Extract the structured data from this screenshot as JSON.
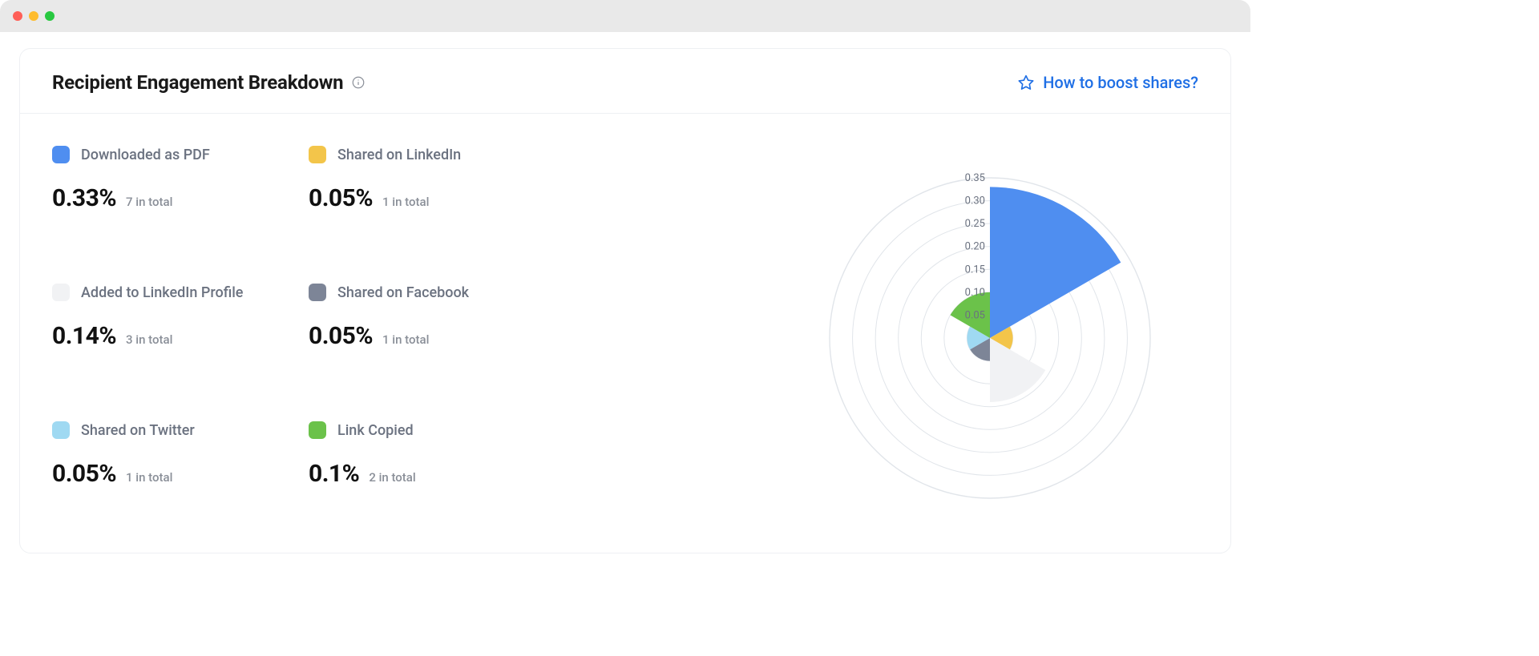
{
  "header": {
    "title": "Recipient Engagement Breakdown",
    "boost_link_label": "How to boost shares?"
  },
  "metrics": [
    {
      "key": "downloaded_pdf",
      "label": "Downloaded as PDF",
      "percent": "0.33%",
      "total": "7 in total",
      "color": "#4f8ef0"
    },
    {
      "key": "shared_linkedin",
      "label": "Shared on LinkedIn",
      "percent": "0.05%",
      "total": "1 in total",
      "color": "#f3c54a"
    },
    {
      "key": "added_linkedin",
      "label": "Added to LinkedIn Profile",
      "percent": "0.14%",
      "total": "3 in total",
      "color": "#f1f2f4"
    },
    {
      "key": "shared_facebook",
      "label": "Shared on Facebook",
      "percent": "0.05%",
      "total": "1 in total",
      "color": "#7d8597"
    },
    {
      "key": "shared_twitter",
      "label": "Shared on Twitter",
      "percent": "0.05%",
      "total": "1 in total",
      "color": "#9fd9f2"
    },
    {
      "key": "link_copied",
      "label": "Link Copied",
      "percent": "0.1%",
      "total": "2 in total",
      "color": "#6bc24a"
    }
  ],
  "chart_data": {
    "type": "pie",
    "subtype": "polar-area-rose",
    "ticks": [
      0.05,
      0.1,
      0.15,
      0.2,
      0.25,
      0.3,
      0.35
    ],
    "tick_labels": [
      "0.05",
      "0.10",
      "0.15",
      "0.20",
      "0.25",
      "0.30",
      "0.35"
    ],
    "max": 0.35,
    "series": [
      {
        "name": "Downloaded as PDF",
        "value": 0.33,
        "color": "#4f8ef0"
      },
      {
        "name": "Shared on LinkedIn",
        "value": 0.05,
        "color": "#f3c54a"
      },
      {
        "name": "Added to LinkedIn Profile",
        "value": 0.14,
        "color": "#f1f2f4"
      },
      {
        "name": "Shared on Facebook",
        "value": 0.05,
        "color": "#7d8597"
      },
      {
        "name": "Shared on Twitter",
        "value": 0.05,
        "color": "#9fd9f2"
      },
      {
        "name": "Link Copied",
        "value": 0.1,
        "color": "#6bc24a"
      }
    ]
  }
}
